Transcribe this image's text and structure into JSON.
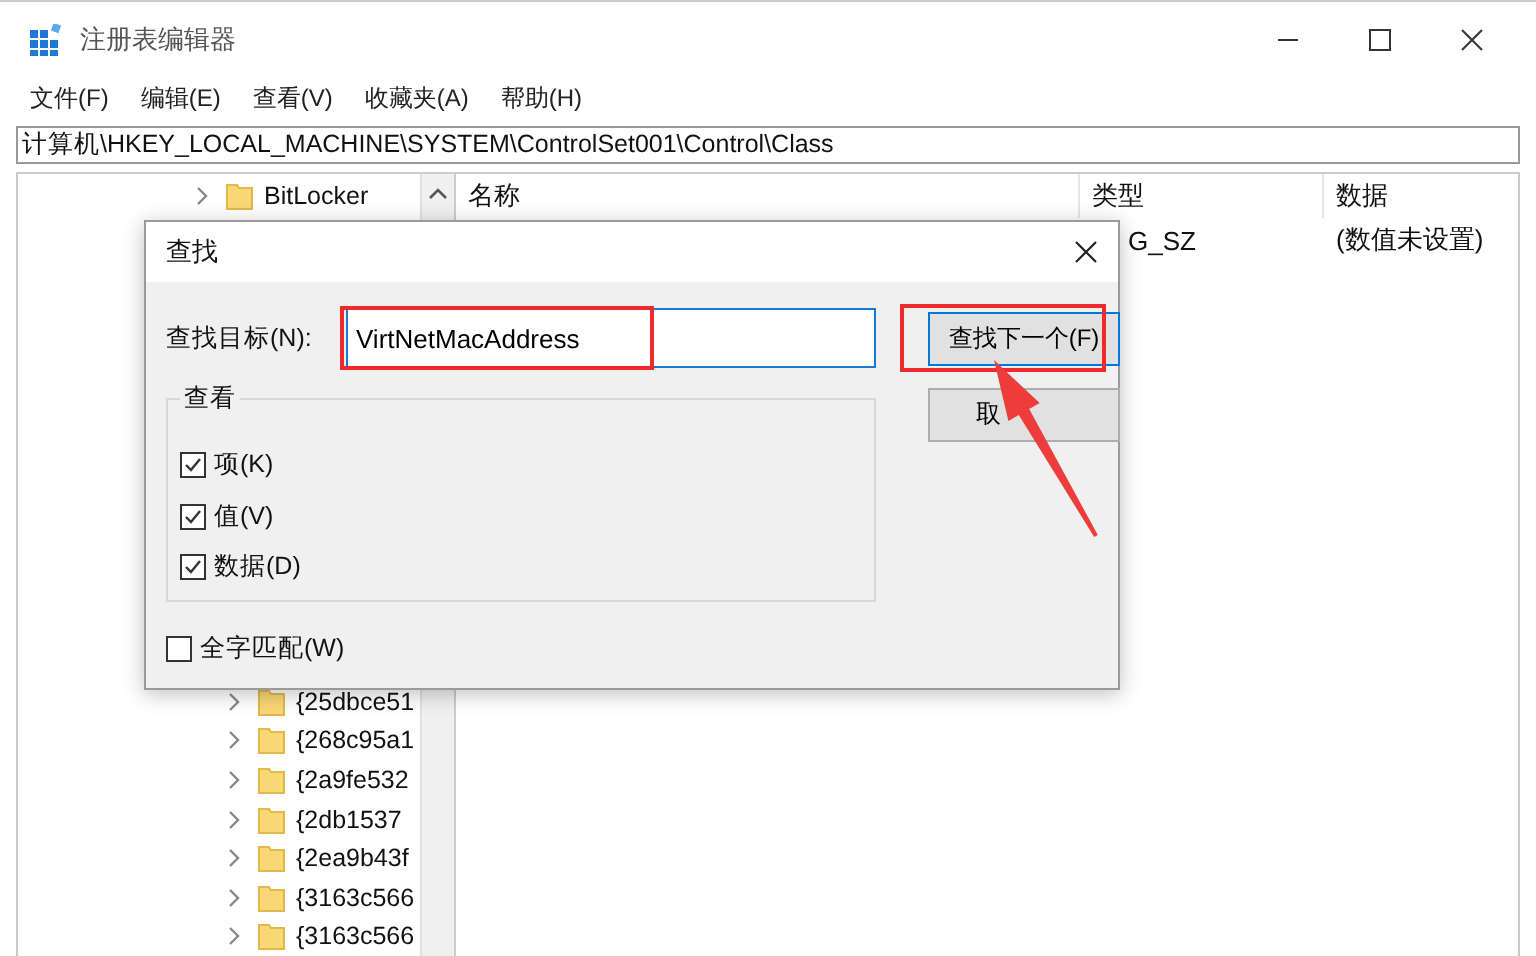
{
  "window": {
    "title": "注册表编辑器"
  },
  "menu": [
    "文件(F)",
    "编辑(E)",
    "查看(V)",
    "收藏夹(A)",
    "帮助(H)"
  ],
  "address": "计算机\\HKEY_LOCAL_MACHINE\\SYSTEM\\ControlSet001\\Control\\Class",
  "tree_upper": [
    {
      "label": "BitLocker",
      "expanded": false
    }
  ],
  "tree_lower": [
    {
      "label": "{25dbce51",
      "expanded": false
    },
    {
      "label": "{268c95a1",
      "expanded": false
    },
    {
      "label": "{2a9fe532",
      "expanded": false
    },
    {
      "label": "{2db1537",
      "expanded": false
    },
    {
      "label": "{2ea9b43f",
      "expanded": false
    },
    {
      "label": "{3163c566",
      "expanded": false
    },
    {
      "label": "{3163c566",
      "expanded": false
    }
  ],
  "values": {
    "columns": [
      "名称",
      "类型",
      "数据"
    ],
    "rows": [
      {
        "type": "G_SZ",
        "data": "(数值未设置)"
      }
    ]
  },
  "dialog": {
    "title": "查找",
    "find_label": "查找目标(N):",
    "find_value": "VirtNetMacAddress",
    "buttons": [
      {
        "label": "查找下一个(F)",
        "default": true
      },
      {
        "label": "取",
        "default": false
      }
    ],
    "group_title": "查看",
    "options": [
      {
        "label": "项(K)",
        "checked": true
      },
      {
        "label": "值(V)",
        "checked": true
      },
      {
        "label": "数据(D)",
        "checked": true
      }
    ],
    "whole_word": {
      "label": "全字匹配(W)",
      "checked": false
    }
  }
}
